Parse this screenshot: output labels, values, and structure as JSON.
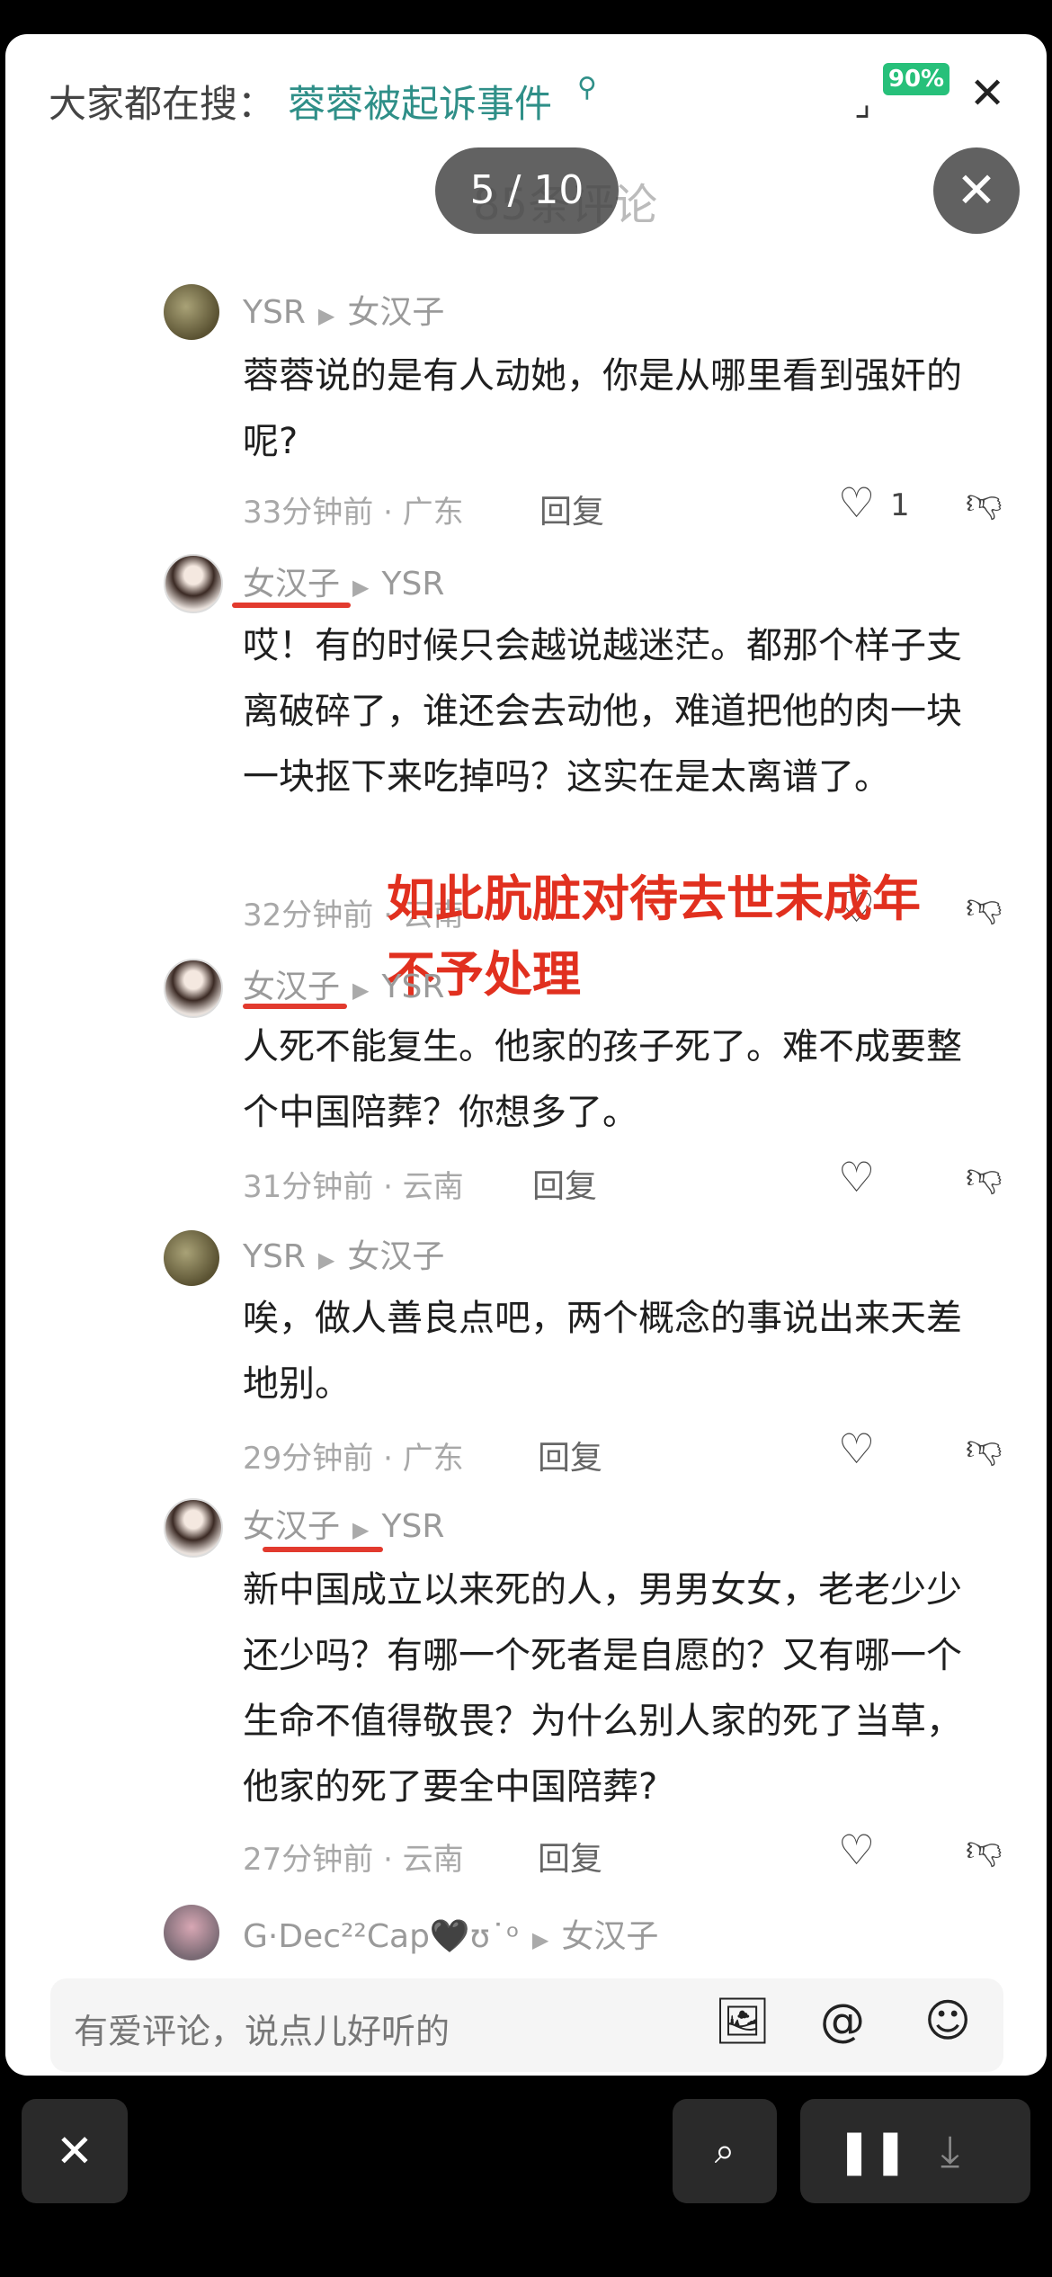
{
  "search": {
    "prefix": "大家都在搜：",
    "topic": "蓉蓉被起诉事件",
    "search_icon": "search-icon",
    "battery": "90%",
    "close_label": "✕"
  },
  "faded_counter": "85条评论",
  "viewer": {
    "counter": "5 / 10",
    "close_label": "✕"
  },
  "comments": [
    {
      "author": "YSR",
      "reply_to": "女汉子",
      "text": "蓉蓉说的是有人动她，你是从哪里看到强奸的呢?",
      "time_location": "33分钟前 · 广东",
      "reply_label": "回复",
      "likes": "1"
    },
    {
      "author": "女汉子",
      "reply_to": "YSR",
      "text": "哎！有的时候只会越说越迷茫。都那个样子支离破碎了，谁还会去动他，难道把他的肉一块一块抠下来吃掉吗？这实在是太离谱了。",
      "time_location": "32分钟前 · 云南",
      "reply_label": "回复",
      "likes": ""
    },
    {
      "author": "女汉子",
      "reply_to": "YSR",
      "text": "人死不能复生。他家的孩子死了。难不成要整个中国陪葬？你想多了。",
      "time_location": "31分钟前 · 云南",
      "reply_label": "回复",
      "likes": ""
    },
    {
      "author": "YSR",
      "reply_to": "女汉子",
      "text": "唉，做人善良点吧，两个概念的事说出来天差地别。",
      "time_location": "29分钟前 · 广东",
      "reply_label": "回复",
      "likes": ""
    },
    {
      "author": "女汉子",
      "reply_to": "YSR",
      "text": "新中国成立以来死的人，男男女女，老老少少还少吗？有哪一个死者是自愿的？又有哪一个生命不值得敬畏？为什么别人家的死了当草，他家的死了要全中国陪葬?",
      "time_location": "27分钟前 · 云南",
      "reply_label": "回复",
      "likes": ""
    },
    {
      "author": "G·Dec²²Cap🖤ʊ˙ᵒ",
      "reply_to": "女汉子"
    }
  ],
  "overlay_text": {
    "line1": "如此肮脏对待去世未成年",
    "line2": "不予处理"
  },
  "input": {
    "placeholder": "有爱评论，说点儿好听的"
  },
  "colors": {
    "accent_teal": "#2f8f88",
    "annotation_red": "#e1301f",
    "battery_green": "#27c07a"
  }
}
